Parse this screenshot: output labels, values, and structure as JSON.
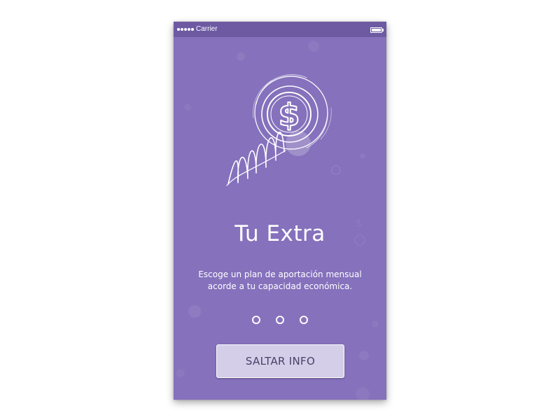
{
  "status_bar": {
    "carrier": "Carrier"
  },
  "onboarding": {
    "title": "Tu Extra",
    "description_line1": "Escoge un plan de aportación mensual",
    "description_line2": "acorde a tu capacidad económica.",
    "page_count": 3,
    "skip_label": "SALTAR INFO"
  },
  "icons": {
    "hero": "coin-spring-dollar-icon",
    "signal": "signal-dots-icon",
    "battery": "battery-icon"
  },
  "colors": {
    "background": "#8571bc",
    "status_bar": "#6d5aa3",
    "button_fill": "#d5cee8",
    "button_text": "#4a4069",
    "foreground": "#ffffff"
  }
}
